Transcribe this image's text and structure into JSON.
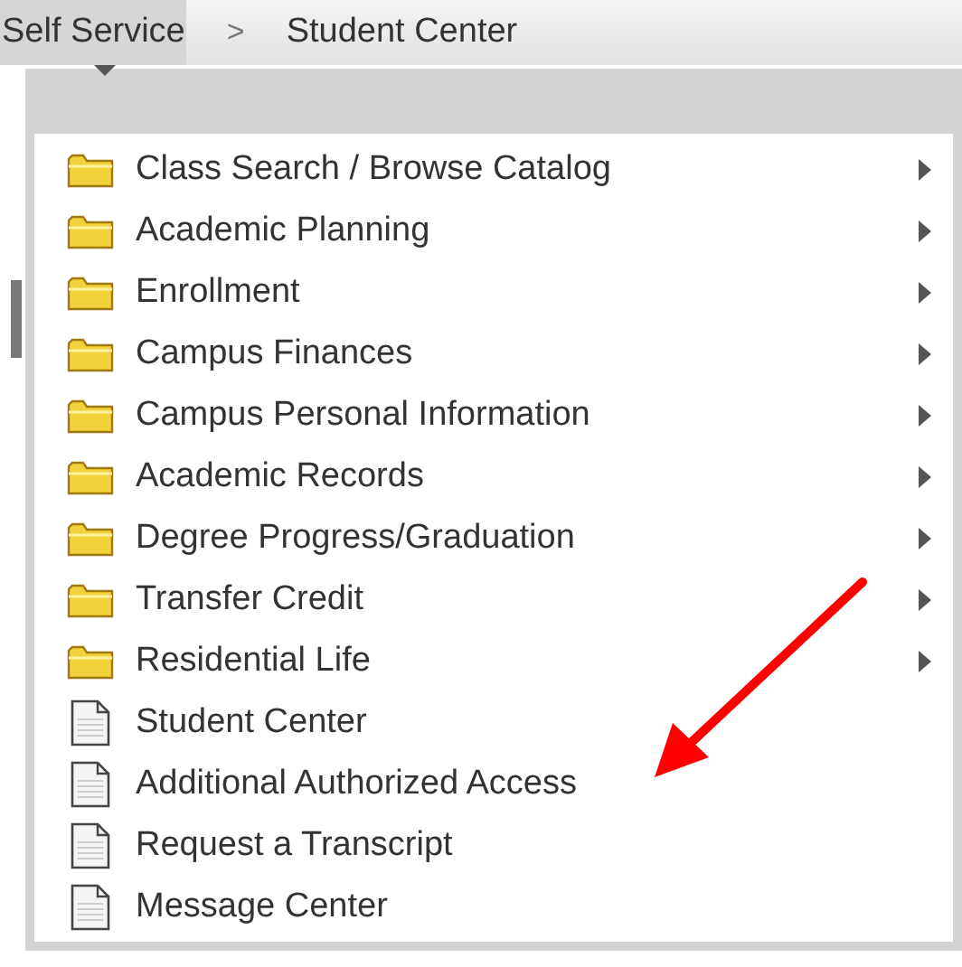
{
  "breadcrumb": {
    "items": [
      {
        "label": "Self Service",
        "selected": true
      },
      {
        "label": "Student Center",
        "selected": false
      }
    ],
    "separator": ">"
  },
  "menu": {
    "items": [
      {
        "label": "Class Search / Browse Catalog",
        "kind": "folder"
      },
      {
        "label": "Academic Planning",
        "kind": "folder"
      },
      {
        "label": "Enrollment",
        "kind": "folder"
      },
      {
        "label": "Campus Finances",
        "kind": "folder"
      },
      {
        "label": "Campus Personal Information",
        "kind": "folder"
      },
      {
        "label": "Academic Records",
        "kind": "folder"
      },
      {
        "label": "Degree Progress/Graduation",
        "kind": "folder"
      },
      {
        "label": "Transfer Credit",
        "kind": "folder"
      },
      {
        "label": "Residential Life",
        "kind": "folder"
      },
      {
        "label": "Student Center",
        "kind": "page"
      },
      {
        "label": "Additional Authorized Access",
        "kind": "page"
      },
      {
        "label": "Request a Transcript",
        "kind": "page"
      },
      {
        "label": "Message Center",
        "kind": "page"
      }
    ]
  }
}
